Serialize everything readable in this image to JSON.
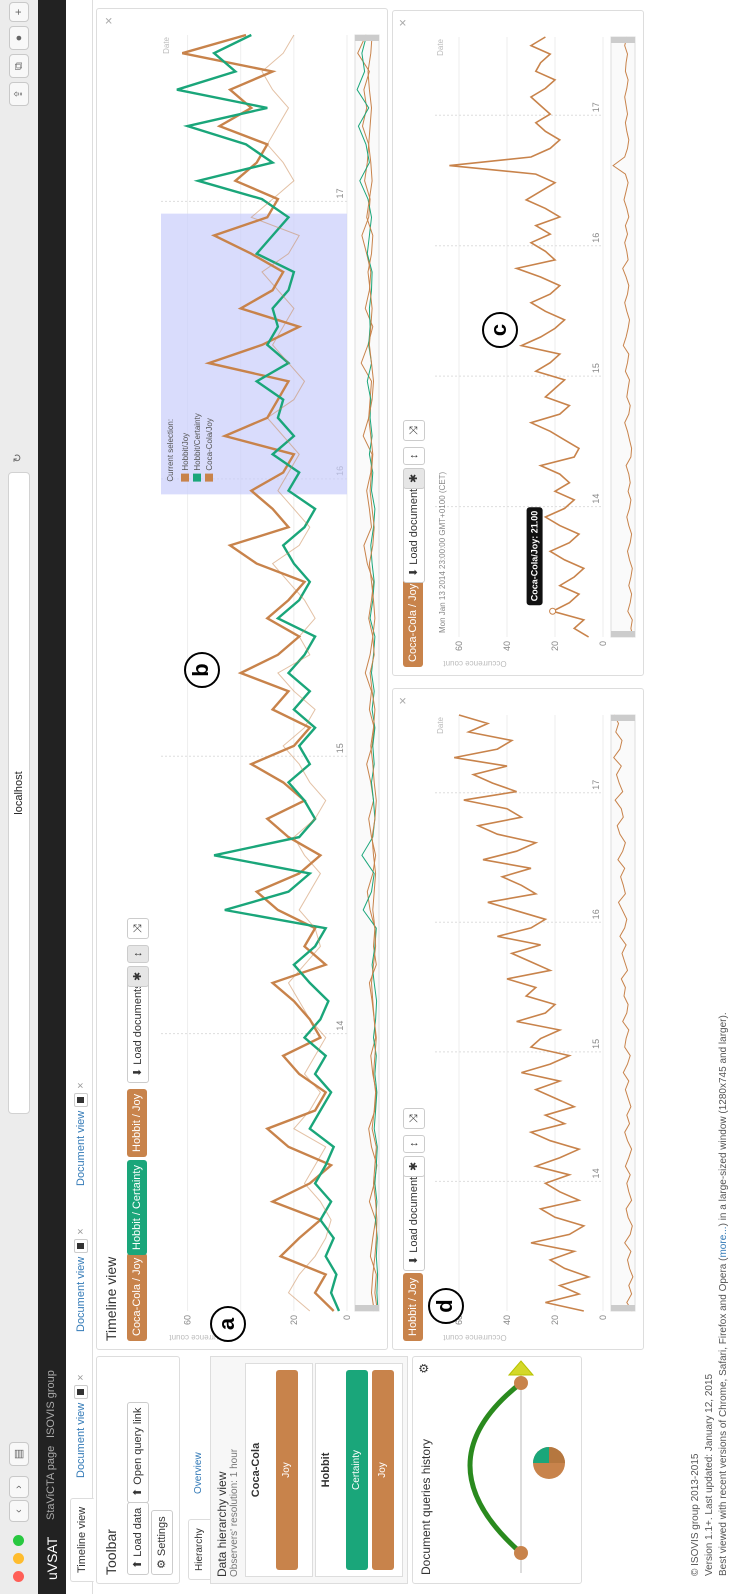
{
  "browser": {
    "url": "localhost"
  },
  "nav": {
    "brand": "uVSAT",
    "links": [
      "StaViCTA page",
      "ISOVIS group"
    ]
  },
  "tabs": [
    {
      "label": "Timeline view"
    },
    {
      "label": "Document view"
    },
    {
      "label": "Document view"
    },
    {
      "label": "Document view"
    }
  ],
  "toolbar": {
    "title": "Toolbar",
    "load_data": "Load data",
    "open_query": "Open query link",
    "settings": "Settings"
  },
  "hierarchy": {
    "tabs": [
      "Hierarchy",
      "Overview"
    ],
    "title": "Data hierarchy view",
    "subtitle": "Observers' resolution: 1 hour",
    "groups": [
      {
        "name": "Coca-Cola",
        "bars": [
          {
            "label": "Joy",
            "color": "#c8834b"
          }
        ]
      },
      {
        "name": "Hobbit",
        "bars": [
          {
            "label": "Certainty",
            "color": "#1aa67a"
          },
          {
            "label": "Joy",
            "color": "#c8834b"
          }
        ]
      }
    ]
  },
  "history": {
    "title": "Document queries history"
  },
  "timeline": {
    "title": "Timeline view",
    "chips": [
      {
        "label": "Coca-Cola / Joy",
        "color": "#c8834b"
      },
      {
        "label": "Hobbit / Certainty",
        "color": "#1aa67a"
      },
      {
        "label": "Hobbit / Joy",
        "color": "#c8834b"
      }
    ],
    "load_documents": "Load documents",
    "selection": {
      "title": "Current selection:",
      "items": [
        "Hobbit/Joy",
        "Hobbit/Certainty",
        "Coca-Cola/Joy"
      ]
    }
  },
  "charts": {
    "y_label": "Occurrence count",
    "x_label": "Date",
    "y_ticks": [
      "60",
      "40",
      "20",
      "0"
    ],
    "x_ticks": [
      "14",
      "15",
      "16",
      "17"
    ],
    "panel_c": {
      "chip": "Coca-Cola / Joy",
      "load_documents": "Load documents",
      "date": "Mon Jan 13 2014 23:00:00 GMT+0100 (CET)",
      "tooltip": "Coca-Cola/Joy: 21.00"
    },
    "panel_left": {
      "chip": "Hobbit / Joy",
      "load_documents": "Load documents"
    }
  },
  "annotations": [
    "a",
    "b",
    "c",
    "d"
  ],
  "footer": {
    "line1": "© ISOVIS group 2013-2015",
    "line2": "Version 1.1+. Last updated: January 12, 2015",
    "line3_a": "Best viewed with recent versions of Chrome, Safari, Firefox and Opera (",
    "line3_link": "more...",
    "line3_b": ") in a large-sized window (1280x745 and larger)."
  },
  "colors": {
    "joy": "#c8834b",
    "certainty": "#1aa67a",
    "selection": "#c9cdfb"
  },
  "chart_data": [
    {
      "type": "line",
      "title": "",
      "ylabel": "Occurrence count",
      "xlabel": "Date",
      "x_ticks": [
        "14",
        "15",
        "16",
        "17"
      ],
      "ylim": [
        0,
        70
      ],
      "series": [
        {
          "name": "Hobbit/Joy",
          "color": "#c8834b",
          "values": [
            5,
            12,
            8,
            25,
            18,
            10,
            28,
            14,
            6,
            22,
            30,
            12,
            8,
            18,
            24,
            10,
            14,
            20,
            28,
            8,
            16,
            12,
            26,
            34,
            18,
            10,
            22,
            30,
            16,
            24,
            36,
            20,
            14,
            28,
            22,
            40,
            26,
            18,
            30,
            22,
            16,
            34,
            44,
            22,
            28,
            36,
            24,
            20,
            46,
            30,
            26,
            22,
            52,
            32,
            18,
            40,
            28,
            24,
            36,
            50,
            30,
            26,
            42,
            34,
            30,
            48,
            36,
            44,
            28,
            62,
            38
          ]
        },
        {
          "name": "Hobbit/Certainty",
          "color": "#1aa67a",
          "values": [
            3,
            6,
            4,
            8,
            5,
            10,
            6,
            12,
            8,
            5,
            14,
            10,
            6,
            12,
            8,
            16,
            10,
            7,
            14,
            20,
            12,
            8,
            46,
            22,
            14,
            50,
            18,
            12,
            16,
            22,
            14,
            18,
            12,
            20,
            14,
            22,
            16,
            12,
            26,
            18,
            14,
            20,
            24,
            16,
            12,
            22,
            18,
            28,
            20,
            26,
            24,
            34,
            22,
            30,
            26,
            28,
            22,
            20,
            34,
            28,
            22,
            32,
            56,
            28,
            38,
            60,
            30,
            64,
            42,
            50,
            36
          ]
        },
        {
          "name": "Coca-Cola/Joy",
          "color": "#c8834b",
          "values": [
            14,
            22,
            18,
            12,
            8,
            6,
            10,
            16,
            12,
            8,
            20,
            14,
            10,
            16,
            12,
            8,
            14,
            18,
            22,
            16,
            10,
            12,
            18,
            14,
            10,
            16,
            20,
            12,
            8,
            14,
            18,
            24,
            16,
            12,
            20,
            26,
            14,
            18,
            12,
            16,
            22,
            28,
            18,
            14,
            20,
            26,
            22,
            18,
            24,
            30,
            20,
            16,
            22,
            28,
            24,
            20,
            26,
            32,
            22,
            18,
            36,
            28,
            20,
            24,
            30,
            26,
            22,
            28,
            32,
            24,
            20
          ]
        }
      ]
    },
    {
      "type": "line",
      "title": "",
      "ylabel": "Occurrence count",
      "xlabel": "Date",
      "x_ticks": [
        "14",
        "15",
        "16",
        "17"
      ],
      "ylim": [
        0,
        70
      ],
      "series": [
        {
          "name": "Hobbit/Joy",
          "color": "#c8834b",
          "values": [
            8,
            24,
            10,
            18,
            6,
            16,
            22,
            12,
            30,
            14,
            8,
            20,
            26,
            10,
            18,
            24,
            14,
            28,
            18,
            10,
            22,
            30,
            16,
            24,
            12,
            20,
            28,
            18,
            34,
            22,
            14,
            30,
            26,
            18,
            36,
            24,
            20,
            32,
            28,
            40,
            22,
            30,
            38,
            26,
            44,
            30,
            24,
            36,
            48,
            28,
            34,
            42,
            30,
            50,
            36,
            28,
            44,
            52,
            34,
            40,
            58,
            36,
            46,
            54,
            40,
            62,
            44,
            38,
            56,
            48,
            60
          ]
        }
      ]
    },
    {
      "type": "line",
      "title": "",
      "ylabel": "Occurrence count",
      "xlabel": "Date",
      "x_ticks": [
        "14",
        "15",
        "16",
        "17"
      ],
      "ylim": [
        0,
        70
      ],
      "series": [
        {
          "name": "Coca-Cola/Joy",
          "color": "#c8834b",
          "values": [
            6,
            12,
            8,
            21,
            14,
            10,
            18,
            12,
            8,
            16,
            22,
            14,
            10,
            18,
            24,
            16,
            12,
            20,
            14,
            18,
            26,
            12,
            10,
            16,
            22,
            30,
            18,
            14,
            24,
            20,
            16,
            28,
            22,
            18,
            34,
            26,
            20,
            16,
            24,
            30,
            22,
            18,
            26,
            36,
            20,
            24,
            30,
            22,
            28,
            18,
            24,
            32,
            26,
            20,
            28,
            64,
            30,
            22,
            18,
            24,
            28,
            22,
            26,
            30,
            24,
            20,
            28,
            26,
            22,
            30,
            24
          ]
        }
      ]
    }
  ]
}
